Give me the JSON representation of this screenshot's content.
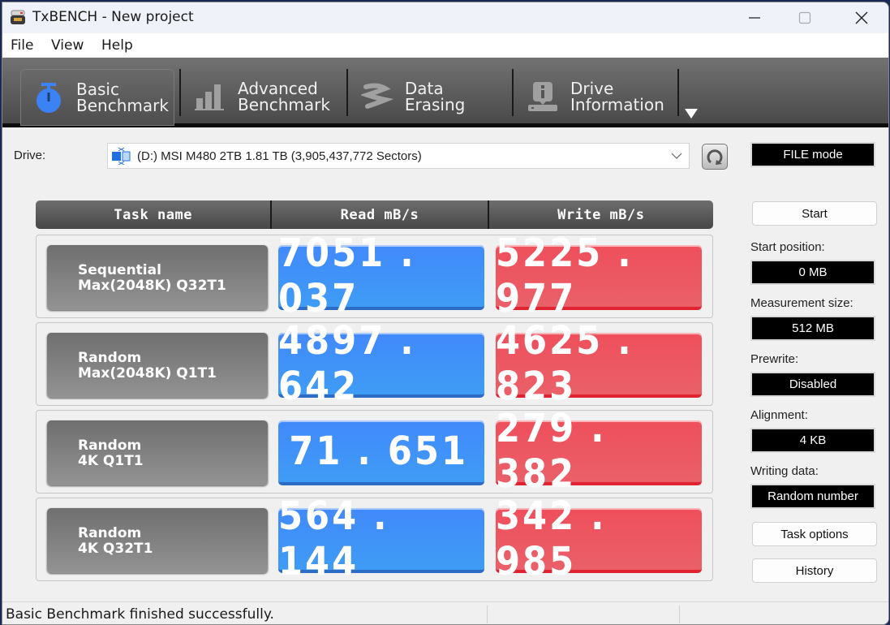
{
  "window": {
    "title": "TxBENCH - New project",
    "controls": [
      "minimize",
      "maximize",
      "close"
    ]
  },
  "menu": [
    "File",
    "View",
    "Help"
  ],
  "toolbar": {
    "tabs": [
      {
        "line1": "Basic",
        "line2": "Benchmark",
        "icon": "stopwatch-icon",
        "active": true
      },
      {
        "line1": "Advanced",
        "line2": "Benchmark",
        "icon": "bar-chart-icon",
        "active": false
      },
      {
        "line1": "Data Erasing",
        "line2": "",
        "icon": "eraser-spring-icon",
        "active": false
      },
      {
        "line1": "Drive",
        "line2": "Information",
        "icon": "drive-info-icon",
        "active": false
      }
    ],
    "more_icon": "triangle-down-icon"
  },
  "drive": {
    "label": "Drive:",
    "selected": "(D:) MSI M480 2TB  1.81 TB (3,905,437,772 Sectors)",
    "mode": "FILE mode"
  },
  "table": {
    "headers": [
      "Task name",
      "Read mB/s",
      "Write mB/s"
    ],
    "rows": [
      {
        "name1": "Sequential",
        "name2": "Max(2048K) Q32T1",
        "read": "7051.037",
        "write": "5225.977"
      },
      {
        "name1": "Random",
        "name2": "Max(2048K) Q1T1",
        "read": "4897.642",
        "write": "4625.823"
      },
      {
        "name1": "Random",
        "name2": "4K Q1T1",
        "read": "71.651",
        "write": "279.382"
      },
      {
        "name1": "Random",
        "name2": "4K Q32T1",
        "read": "564.144",
        "write": "342.985"
      }
    ]
  },
  "side": {
    "start_label": "Start",
    "start_position_label": "Start position:",
    "start_position": "0 MB",
    "measurement_size_label": "Measurement size:",
    "measurement_size": "512 MB",
    "prewrite_label": "Prewrite:",
    "prewrite": "Disabled",
    "alignment_label": "Alignment:",
    "alignment": "4 KB",
    "writing_data_label": "Writing data:",
    "writing_data": "Random number",
    "task_options_label": "Task options",
    "history_label": "History"
  },
  "status": {
    "message": "Basic Benchmark finished successfully."
  },
  "colors": {
    "read": "#4189fb",
    "write": "#ee4f5b",
    "toolbar": "#5a5a5a",
    "task": "#7f7f7f"
  }
}
